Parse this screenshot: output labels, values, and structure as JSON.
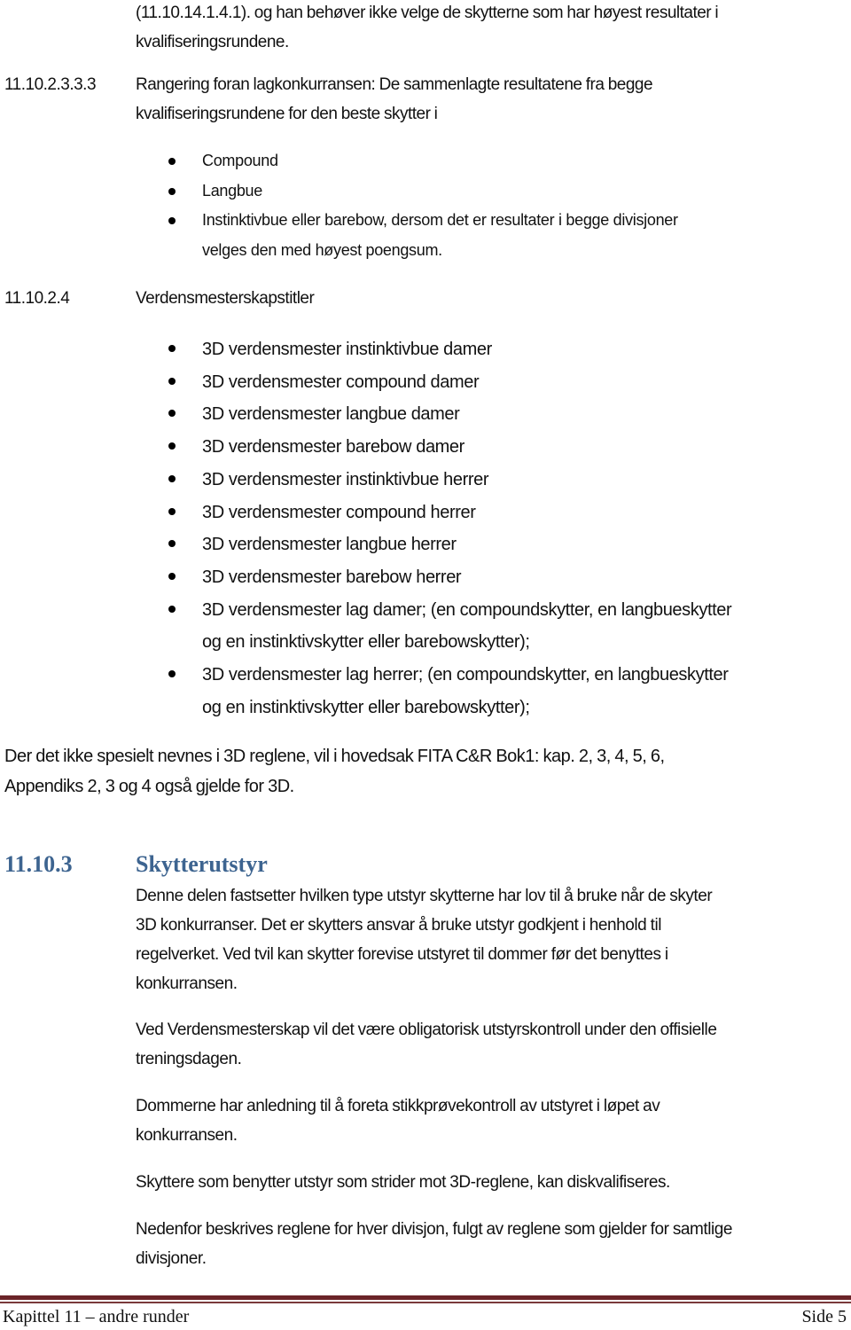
{
  "intro": {
    "lines": [
      "(11.10.14.1.4.1). og han behøver ikke velge de skytterne som har høyest resultater i",
      "kvalifiseringsrundene."
    ]
  },
  "section_2_3_3_3": {
    "number": "11.10.2.3.3.3",
    "lines": [
      "Rangering foran lagkonkurransen: De sammenlagte resultatene fra begge",
      "kvalifiseringsrundene for den beste skytter i"
    ],
    "bullets": [
      "Compound",
      "Langbue",
      "Instinktivbue eller barebow, dersom det er resultater i begge divisjoner",
      "velges den med høyest poengsum."
    ]
  },
  "section_2_4": {
    "number": "11.10.2.4",
    "title": "Verdensmesterskapstitler",
    "bullets": [
      "3D verdensmester instinktivbue damer",
      "3D verdensmester compound damer",
      "3D verdensmester langbue damer",
      "3D verdensmester barebow damer",
      "3D verdensmester instinktivbue herrer",
      "3D verdensmester compound herrer",
      "3D verdensmester langbue herrer",
      "3D verdensmester barebow herrer",
      "3D verdensmester lag damer; (en compoundskytter, en langbueskytter",
      "og en instinktivskytter eller barebowskytter);",
      "3D verdensmester lag herrer; (en compoundskytter, en langbueskytter",
      "og en instinktivskytter eller barebowskytter);"
    ]
  },
  "general_note": {
    "lines": [
      "Der det ikke spesielt nevnes i 3D reglene, vil i hovedsak FITA C&R Bok1: kap. 2, 3, 4, 5, 6,",
      "Appendiks 2, 3 og 4 også gjelde for 3D."
    ]
  },
  "section_3": {
    "number": "11.10.3",
    "title": "Skytterutstyr",
    "color": "#3d6490",
    "paragraphs": [
      [
        "Denne delen fastsetter hvilken type utstyr skytterne har lov til å bruke når de skyter",
        "3D konkurranser. Det er skytters ansvar å bruke utstyr godkjent i henhold til",
        "regelverket. Ved tvil kan skytter forevise utstyret til dommer før det benyttes i",
        "konkurransen."
      ],
      [
        "Ved Verdensmesterskap vil det være obligatorisk utstyrskontroll under den offisielle",
        "treningsdagen."
      ],
      [
        "Dommerne har anledning til å foreta stikkprøvekontroll av utstyret i løpet av",
        "konkurransen."
      ],
      [
        "Skyttere som benytter utstyr som strider mot 3D-reglene, kan diskvalifiseres."
      ],
      [
        "Nedenfor beskrives reglene for hver divisjon, fulgt av reglene som gjelder for samtlige",
        "divisjoner."
      ]
    ]
  },
  "footer": {
    "left": "Kapittel 11 – andre runder",
    "right": "Side 5",
    "rule_color": "#6b2428"
  }
}
